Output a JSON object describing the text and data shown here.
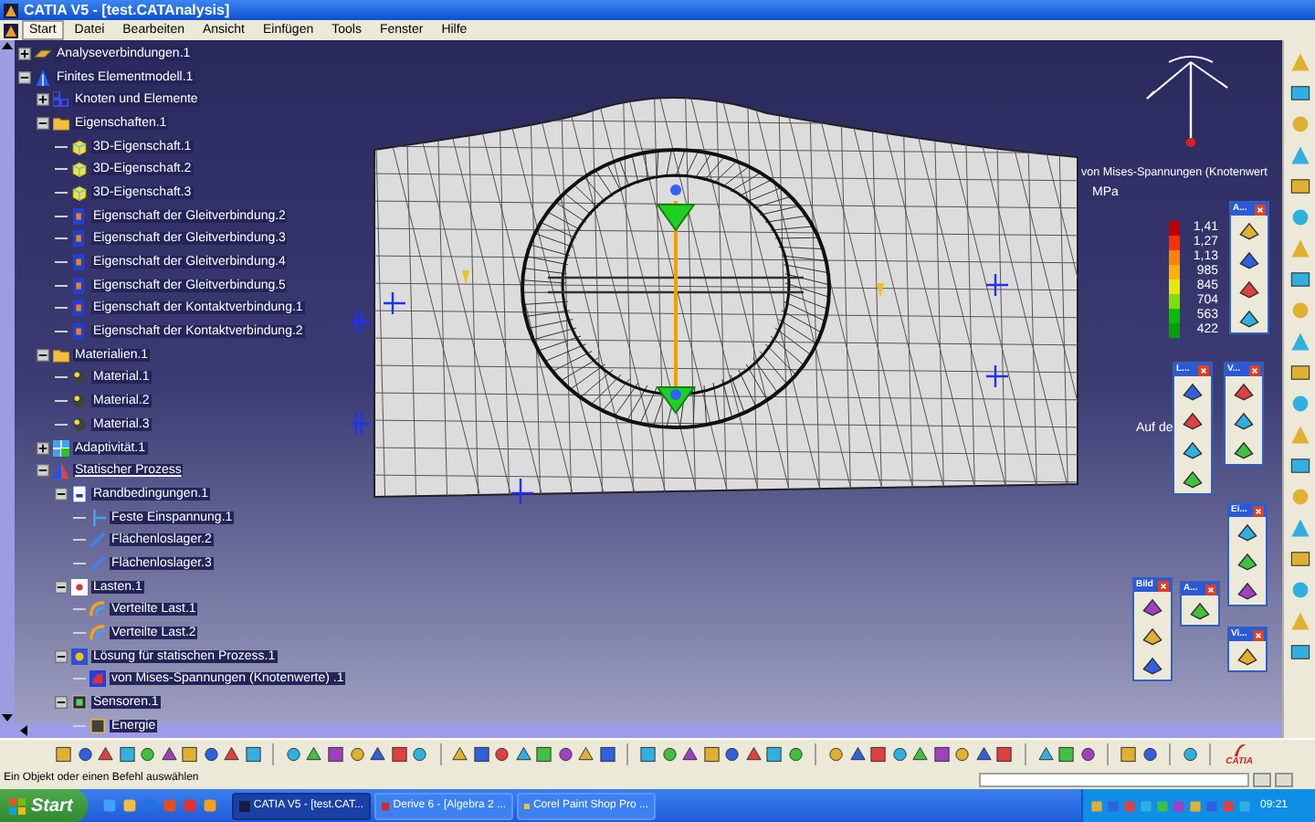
{
  "window": {
    "title": "CATIA V5 - [test.CATAnalysis]"
  },
  "menu": [
    {
      "label": "Start",
      "selected": true
    },
    {
      "label": "Datei",
      "selected": false
    },
    {
      "label": "Bearbeiten",
      "selected": false
    },
    {
      "label": "Ansicht",
      "selected": false
    },
    {
      "label": "Einfügen",
      "selected": false
    },
    {
      "label": "Tools",
      "selected": false
    },
    {
      "label": "Fenster",
      "selected": false
    },
    {
      "label": "Hilfe",
      "selected": false
    }
  ],
  "tree": [
    {
      "label": "Analyseverbindungen.1",
      "kind": "connections",
      "expanded": false,
      "current": false
    },
    {
      "label": "Finites Elementmodell.1",
      "kind": "model",
      "expanded": true,
      "current": false,
      "children": [
        {
          "label": "Knoten und Elemente",
          "kind": "nodes",
          "expanded": false,
          "current": false
        },
        {
          "label": "Eigenschaften.1",
          "kind": "folder",
          "expanded": true,
          "current": false,
          "children": [
            {
              "label": "3D-Eigenschaft.1",
              "kind": "solid",
              "current": false
            },
            {
              "label": "3D-Eigenschaft.2",
              "kind": "solid",
              "current": false
            },
            {
              "label": "3D-Eigenschaft.3",
              "kind": "solid",
              "current": false
            },
            {
              "label": "Eigenschaft der Gleitverbindung.2",
              "kind": "property",
              "current": false
            },
            {
              "label": "Eigenschaft der Gleitverbindung.3",
              "kind": "property",
              "current": false
            },
            {
              "label": "Eigenschaft der Gleitverbindung.4",
              "kind": "property",
              "current": false
            },
            {
              "label": "Eigenschaft der Gleitverbindung.5",
              "kind": "property",
              "current": false
            },
            {
              "label": "Eigenschaft der Kontaktverbindung.1",
              "kind": "property",
              "current": false
            },
            {
              "label": "Eigenschaft der Kontaktverbindung.2",
              "kind": "property",
              "current": false
            }
          ]
        },
        {
          "label": "Materialien.1",
          "kind": "folder",
          "expanded": true,
          "current": false,
          "children": [
            {
              "label": "Material.1",
              "kind": "material",
              "current": false
            },
            {
              "label": "Material.2",
              "kind": "material",
              "current": false
            },
            {
              "label": "Material.3",
              "kind": "material",
              "current": false
            }
          ]
        },
        {
          "label": "Adaptivität.1",
          "kind": "adaptivity",
          "expanded": false,
          "current": false
        },
        {
          "label": "Statischer Prozess",
          "kind": "process",
          "expanded": true,
          "current": true,
          "children": [
            {
              "label": "Randbedingungen.1",
              "kind": "restraints",
              "expanded": true,
              "current": false,
              "children": [
                {
                  "label": "Feste Einspannung.1",
                  "kind": "clamp",
                  "current": false
                },
                {
                  "label": "Flächenloslager.2",
                  "kind": "support",
                  "current": false
                },
                {
                  "label": "Flächenloslager.3",
                  "kind": "support",
                  "current": false
                }
              ]
            },
            {
              "label": "Lasten.1",
              "kind": "loads",
              "expanded": true,
              "current": false,
              "children": [
                {
                  "label": "Verteilte Last.1",
                  "kind": "load",
                  "current": false
                },
                {
                  "label": "Verteilte Last.2",
                  "kind": "load",
                  "current": false
                }
              ]
            },
            {
              "label": "Lösung für statischen Prozess.1",
              "kind": "solution",
              "expanded": true,
              "current": false,
              "children": [
                {
                  "label": "von Mises-Spannungen (Knotenwerte) .1",
                  "kind": "stress",
                  "current": false
                }
              ]
            },
            {
              "label": "Sensoren.1",
              "kind": "sensors",
              "expanded": true,
              "current": false,
              "children": [
                {
                  "label": "Energie",
                  "kind": "energy",
                  "current": false
                }
              ]
            }
          ]
        }
      ]
    }
  ],
  "legend": {
    "title": "von Mises-Spannungen (Knotenwert",
    "unit": "MPa",
    "note": "Auf de",
    "entries": [
      {
        "value": "1,41",
        "color": "#c00000"
      },
      {
        "value": "1,27",
        "color": "#ff3000"
      },
      {
        "value": "1,13",
        "color": "#ff8000"
      },
      {
        "value": "985",
        "color": "#ffb000"
      },
      {
        "value": "845",
        "color": "#e8e800"
      },
      {
        "value": "704",
        "color": "#80e000"
      },
      {
        "value": "563",
        "color": "#00c000"
      },
      {
        "value": "422",
        "color": "#00a000"
      }
    ]
  },
  "palettes": [
    {
      "title": "A..."
    },
    {
      "title": "L..."
    },
    {
      "title": "V..."
    },
    {
      "title": "Ei..."
    },
    {
      "title": "A..."
    },
    {
      "title": "Bild"
    },
    {
      "title": "Vi..."
    }
  ],
  "logo_text": "CATIA",
  "status_bar": {
    "message": "Ein Objekt oder einen Befehl auswählen"
  },
  "taskbar": {
    "start": "Start",
    "tasks": [
      {
        "label": "CATIA V5 - [test.CAT...",
        "selected": true
      },
      {
        "label": "Derive 6 - [Algebra 2 ...",
        "selected": false
      },
      {
        "label": "Corel Paint Shop Pro ...",
        "selected": false
      }
    ],
    "clock": "09:21"
  }
}
